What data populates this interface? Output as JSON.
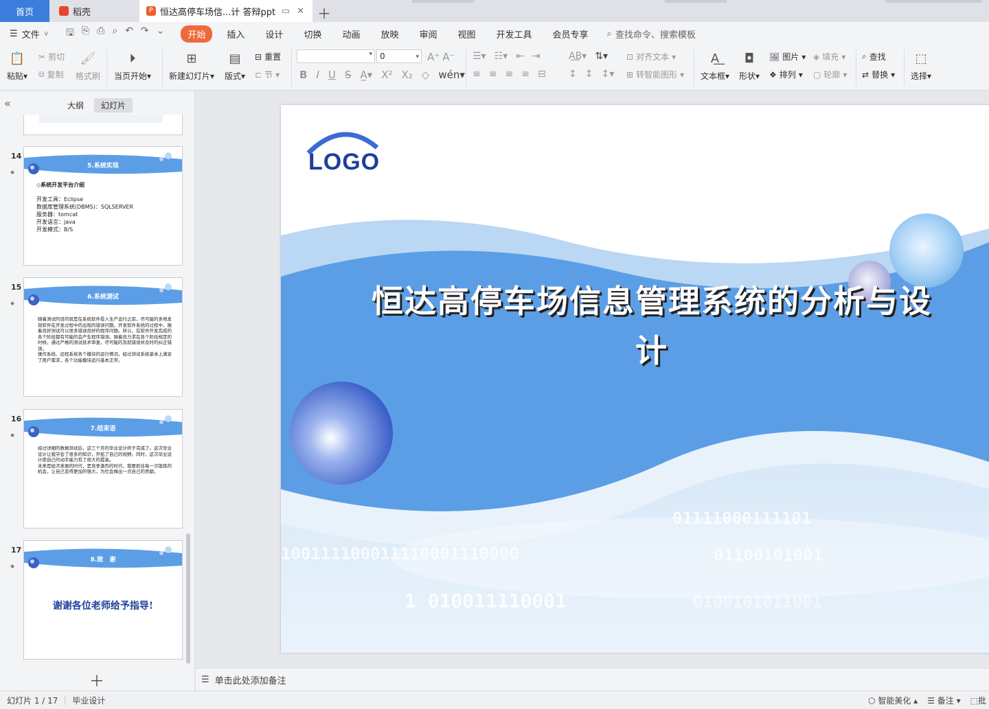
{
  "tabs": {
    "home": "首页",
    "shell": "稻壳",
    "doc": "恒达高停车场信...计 答辩ppt"
  },
  "menu": {
    "file": "文件",
    "tabs": [
      "开始",
      "插入",
      "设计",
      "切换",
      "动画",
      "放映",
      "审阅",
      "视图",
      "开发工具",
      "会员专享"
    ],
    "search": "查找命令、搜索模板"
  },
  "ribbon": {
    "paste": "粘贴",
    "cut": "剪切",
    "copy": "复制",
    "format_painter": "格式刷",
    "from_start": "当页开始",
    "new_slide": "新建幻灯片",
    "layout": "版式",
    "reset": "重置",
    "section": "节",
    "font_size": "0",
    "align_text": "对齐文本",
    "smart_art": "转智能图形",
    "textbox": "文本框",
    "shape": "形状",
    "picture": "图片",
    "arrange": "排列",
    "fill": "填充",
    "outline": "轮廓",
    "find": "查找",
    "replace": "替换",
    "select": "选择"
  },
  "panel": {
    "outline_tab": "大纲",
    "slides_tab": "幻灯片"
  },
  "thumbnails": [
    {
      "num": "14",
      "title": "5.系统实现",
      "lines": [
        "◇系统开发平台介绍",
        "",
        "开发工具：Eclipse",
        "数据库管理系统(DBMS)：SQLSERVER",
        "服务器：tomcat",
        "开发语言：java",
        "开发模式：B/S"
      ]
    },
    {
      "num": "15",
      "title": "6.系统测试",
      "lines": [
        "随着测试的目的就是在系统软件投入生产运行之前，尽可能的多地发现软件在开发过程中的出现的错误问题。开发软件系统的过程中，随着良好测试可以很多错误良好的程序问题。所以，在软件开发完成的各个阶段都有可能的会产生程序错误。随着良力求在各个阶段规定的时候，通过严格的测试技术审查，尽可能的及就错误并及时的纠正错误。",
        "操作系统、远程系统各个模块的运行情况，经过测试系统基本上满足了用户需求，各个功能模块运行基本正常。"
      ]
    },
    {
      "num": "16",
      "title": "7.结束语",
      "lines": [
        "经过详细的数据测试后，这三个月的毕业设计终于完成了。这次毕业设计让我学会了很多的知识，开拓了自己的视野。同时，这次毕业设计使自己的动手能力有了很大的提高。",
        "未来是经济发展的时代，是竞争激烈的时代，我要抓住每一次锻炼的机会，让自己变得更加的强大，为社会做出一点自己的贡献。"
      ]
    },
    {
      "num": "17",
      "title": "8.致　谢",
      "thanks": "谢谢各位老师给予指导!"
    }
  ],
  "slide": {
    "logo": "LOGO",
    "title": "恒达高停车场信息管理系统的分析与设计",
    "binary_1": "01111000111101",
    "binary_2": "100111100011110001110000",
    "binary_3": "01100101001",
    "binary_4": "1 010011110001",
    "binary_5": "0100101011001"
  },
  "notes": {
    "placeholder": "单击此处添加备注"
  },
  "status": {
    "slide_count": "幻灯片 1 / 17",
    "theme": "毕业设计",
    "beautify": "智能美化",
    "notes": "备注",
    "comment": "批"
  },
  "colors": {
    "accent": "#ee6a3c",
    "home_tab": "#3b7ddd",
    "slide_blue": "#5b9ee6",
    "logo_blue": "#1e3f9a"
  }
}
